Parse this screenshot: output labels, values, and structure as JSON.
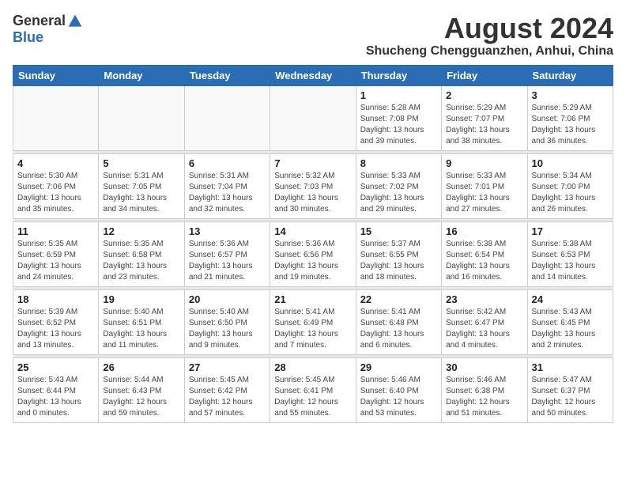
{
  "logo": {
    "general": "General",
    "blue": "Blue"
  },
  "title": "August 2024",
  "subtitle": "Shucheng Chengguanzhen, Anhui, China",
  "days_of_week": [
    "Sunday",
    "Monday",
    "Tuesday",
    "Wednesday",
    "Thursday",
    "Friday",
    "Saturday"
  ],
  "weeks": [
    [
      {
        "day": "",
        "info": ""
      },
      {
        "day": "",
        "info": ""
      },
      {
        "day": "",
        "info": ""
      },
      {
        "day": "",
        "info": ""
      },
      {
        "day": "1",
        "info": "Sunrise: 5:28 AM\nSunset: 7:08 PM\nDaylight: 13 hours\nand 39 minutes."
      },
      {
        "day": "2",
        "info": "Sunrise: 5:29 AM\nSunset: 7:07 PM\nDaylight: 13 hours\nand 38 minutes."
      },
      {
        "day": "3",
        "info": "Sunrise: 5:29 AM\nSunset: 7:06 PM\nDaylight: 13 hours\nand 36 minutes."
      }
    ],
    [
      {
        "day": "4",
        "info": "Sunrise: 5:30 AM\nSunset: 7:06 PM\nDaylight: 13 hours\nand 35 minutes."
      },
      {
        "day": "5",
        "info": "Sunrise: 5:31 AM\nSunset: 7:05 PM\nDaylight: 13 hours\nand 34 minutes."
      },
      {
        "day": "6",
        "info": "Sunrise: 5:31 AM\nSunset: 7:04 PM\nDaylight: 13 hours\nand 32 minutes."
      },
      {
        "day": "7",
        "info": "Sunrise: 5:32 AM\nSunset: 7:03 PM\nDaylight: 13 hours\nand 30 minutes."
      },
      {
        "day": "8",
        "info": "Sunrise: 5:33 AM\nSunset: 7:02 PM\nDaylight: 13 hours\nand 29 minutes."
      },
      {
        "day": "9",
        "info": "Sunrise: 5:33 AM\nSunset: 7:01 PM\nDaylight: 13 hours\nand 27 minutes."
      },
      {
        "day": "10",
        "info": "Sunrise: 5:34 AM\nSunset: 7:00 PM\nDaylight: 13 hours\nand 26 minutes."
      }
    ],
    [
      {
        "day": "11",
        "info": "Sunrise: 5:35 AM\nSunset: 6:59 PM\nDaylight: 13 hours\nand 24 minutes."
      },
      {
        "day": "12",
        "info": "Sunrise: 5:35 AM\nSunset: 6:58 PM\nDaylight: 13 hours\nand 23 minutes."
      },
      {
        "day": "13",
        "info": "Sunrise: 5:36 AM\nSunset: 6:57 PM\nDaylight: 13 hours\nand 21 minutes."
      },
      {
        "day": "14",
        "info": "Sunrise: 5:36 AM\nSunset: 6:56 PM\nDaylight: 13 hours\nand 19 minutes."
      },
      {
        "day": "15",
        "info": "Sunrise: 5:37 AM\nSunset: 6:55 PM\nDaylight: 13 hours\nand 18 minutes."
      },
      {
        "day": "16",
        "info": "Sunrise: 5:38 AM\nSunset: 6:54 PM\nDaylight: 13 hours\nand 16 minutes."
      },
      {
        "day": "17",
        "info": "Sunrise: 5:38 AM\nSunset: 6:53 PM\nDaylight: 13 hours\nand 14 minutes."
      }
    ],
    [
      {
        "day": "18",
        "info": "Sunrise: 5:39 AM\nSunset: 6:52 PM\nDaylight: 13 hours\nand 13 minutes."
      },
      {
        "day": "19",
        "info": "Sunrise: 5:40 AM\nSunset: 6:51 PM\nDaylight: 13 hours\nand 11 minutes."
      },
      {
        "day": "20",
        "info": "Sunrise: 5:40 AM\nSunset: 6:50 PM\nDaylight: 13 hours\nand 9 minutes."
      },
      {
        "day": "21",
        "info": "Sunrise: 5:41 AM\nSunset: 6:49 PM\nDaylight: 13 hours\nand 7 minutes."
      },
      {
        "day": "22",
        "info": "Sunrise: 5:41 AM\nSunset: 6:48 PM\nDaylight: 13 hours\nand 6 minutes."
      },
      {
        "day": "23",
        "info": "Sunrise: 5:42 AM\nSunset: 6:47 PM\nDaylight: 13 hours\nand 4 minutes."
      },
      {
        "day": "24",
        "info": "Sunrise: 5:43 AM\nSunset: 6:45 PM\nDaylight: 13 hours\nand 2 minutes."
      }
    ],
    [
      {
        "day": "25",
        "info": "Sunrise: 5:43 AM\nSunset: 6:44 PM\nDaylight: 13 hours\nand 0 minutes."
      },
      {
        "day": "26",
        "info": "Sunrise: 5:44 AM\nSunset: 6:43 PM\nDaylight: 12 hours\nand 59 minutes."
      },
      {
        "day": "27",
        "info": "Sunrise: 5:45 AM\nSunset: 6:42 PM\nDaylight: 12 hours\nand 57 minutes."
      },
      {
        "day": "28",
        "info": "Sunrise: 5:45 AM\nSunset: 6:41 PM\nDaylight: 12 hours\nand 55 minutes."
      },
      {
        "day": "29",
        "info": "Sunrise: 5:46 AM\nSunset: 6:40 PM\nDaylight: 12 hours\nand 53 minutes."
      },
      {
        "day": "30",
        "info": "Sunrise: 5:46 AM\nSunset: 6:38 PM\nDaylight: 12 hours\nand 51 minutes."
      },
      {
        "day": "31",
        "info": "Sunrise: 5:47 AM\nSunset: 6:37 PM\nDaylight: 12 hours\nand 50 minutes."
      }
    ]
  ]
}
